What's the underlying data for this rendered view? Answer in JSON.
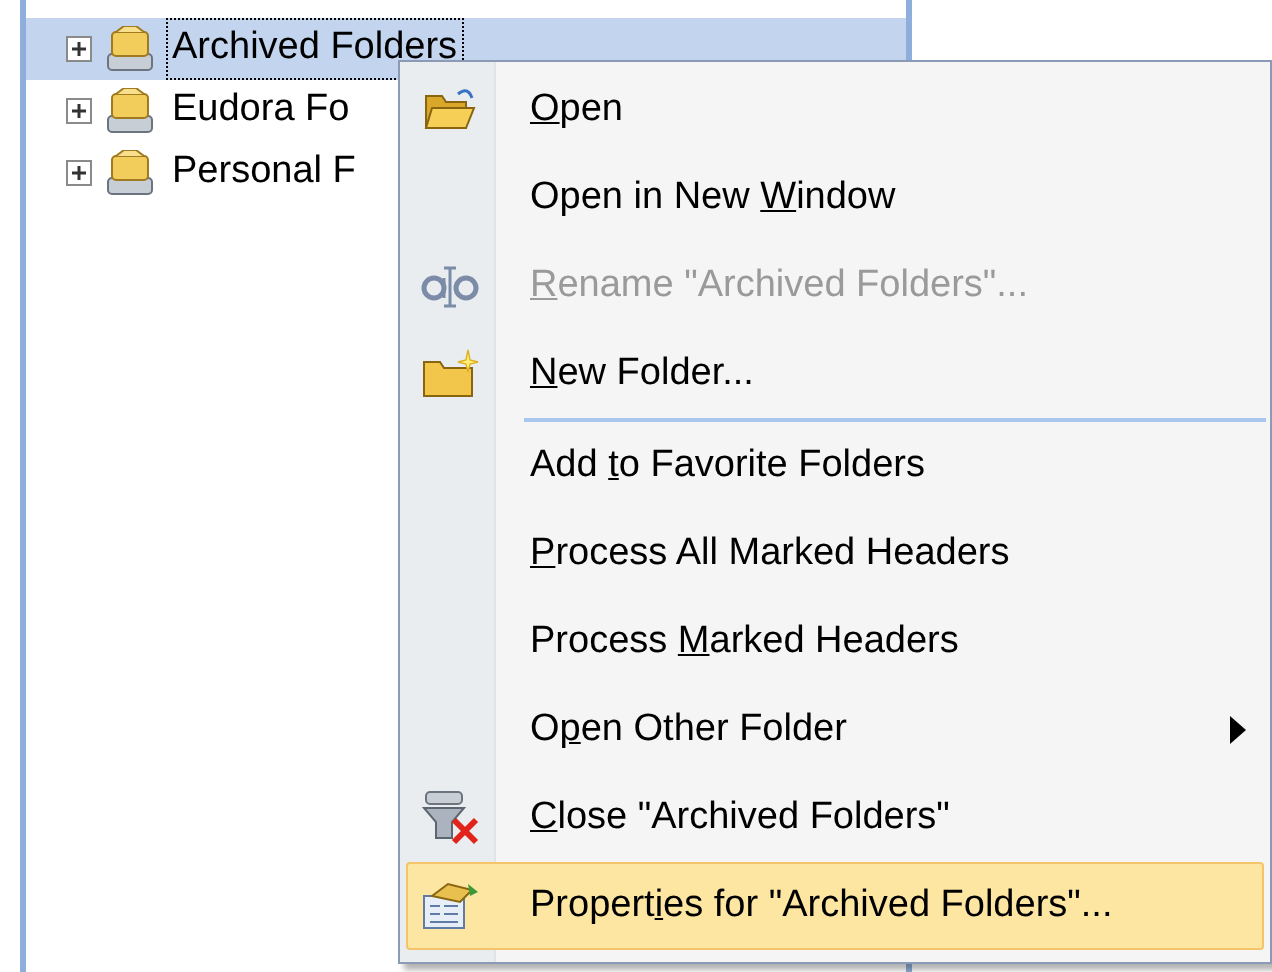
{
  "tree": {
    "items": [
      {
        "label": "Archived Folders",
        "selected": true,
        "expanded": false
      },
      {
        "label": "Eudora Fo",
        "selected": false,
        "expanded": false
      },
      {
        "label": "Personal F",
        "selected": false,
        "expanded": false
      }
    ]
  },
  "context_menu": {
    "items": [
      {
        "kind": "item",
        "key": "O",
        "after": "pen",
        "disabled": false,
        "submenu": false,
        "selected": false
      },
      {
        "kind": "item",
        "before": "Open in New ",
        "key": "W",
        "after": "indow",
        "disabled": false,
        "submenu": false,
        "selected": false
      },
      {
        "kind": "item",
        "key": "R",
        "after": "ename \"Archived Folders\"...",
        "disabled": true,
        "submenu": false,
        "selected": false
      },
      {
        "kind": "item",
        "key": "N",
        "after": "ew Folder...",
        "disabled": false,
        "submenu": false,
        "selected": false
      },
      {
        "kind": "separator"
      },
      {
        "kind": "item",
        "before": "Add ",
        "key": "t",
        "after": "o Favorite Folders",
        "disabled": false,
        "submenu": false,
        "selected": false
      },
      {
        "kind": "item",
        "key": "P",
        "after": "rocess All Marked Headers",
        "disabled": false,
        "submenu": false,
        "selected": false
      },
      {
        "kind": "item",
        "before": "Process ",
        "key": "M",
        "after": "arked Headers",
        "disabled": false,
        "submenu": false,
        "selected": false
      },
      {
        "kind": "item",
        "before": "O",
        "key": "p",
        "after": "en Other Folder",
        "disabled": false,
        "submenu": true,
        "selected": false
      },
      {
        "kind": "item",
        "key": "C",
        "after": "lose \"Archived Folders\"",
        "disabled": false,
        "submenu": false,
        "selected": false
      },
      {
        "kind": "item",
        "before": "Propert",
        "key": "i",
        "after": "es for \"Archived Folders\"...",
        "disabled": false,
        "submenu": false,
        "selected": true
      }
    ]
  }
}
